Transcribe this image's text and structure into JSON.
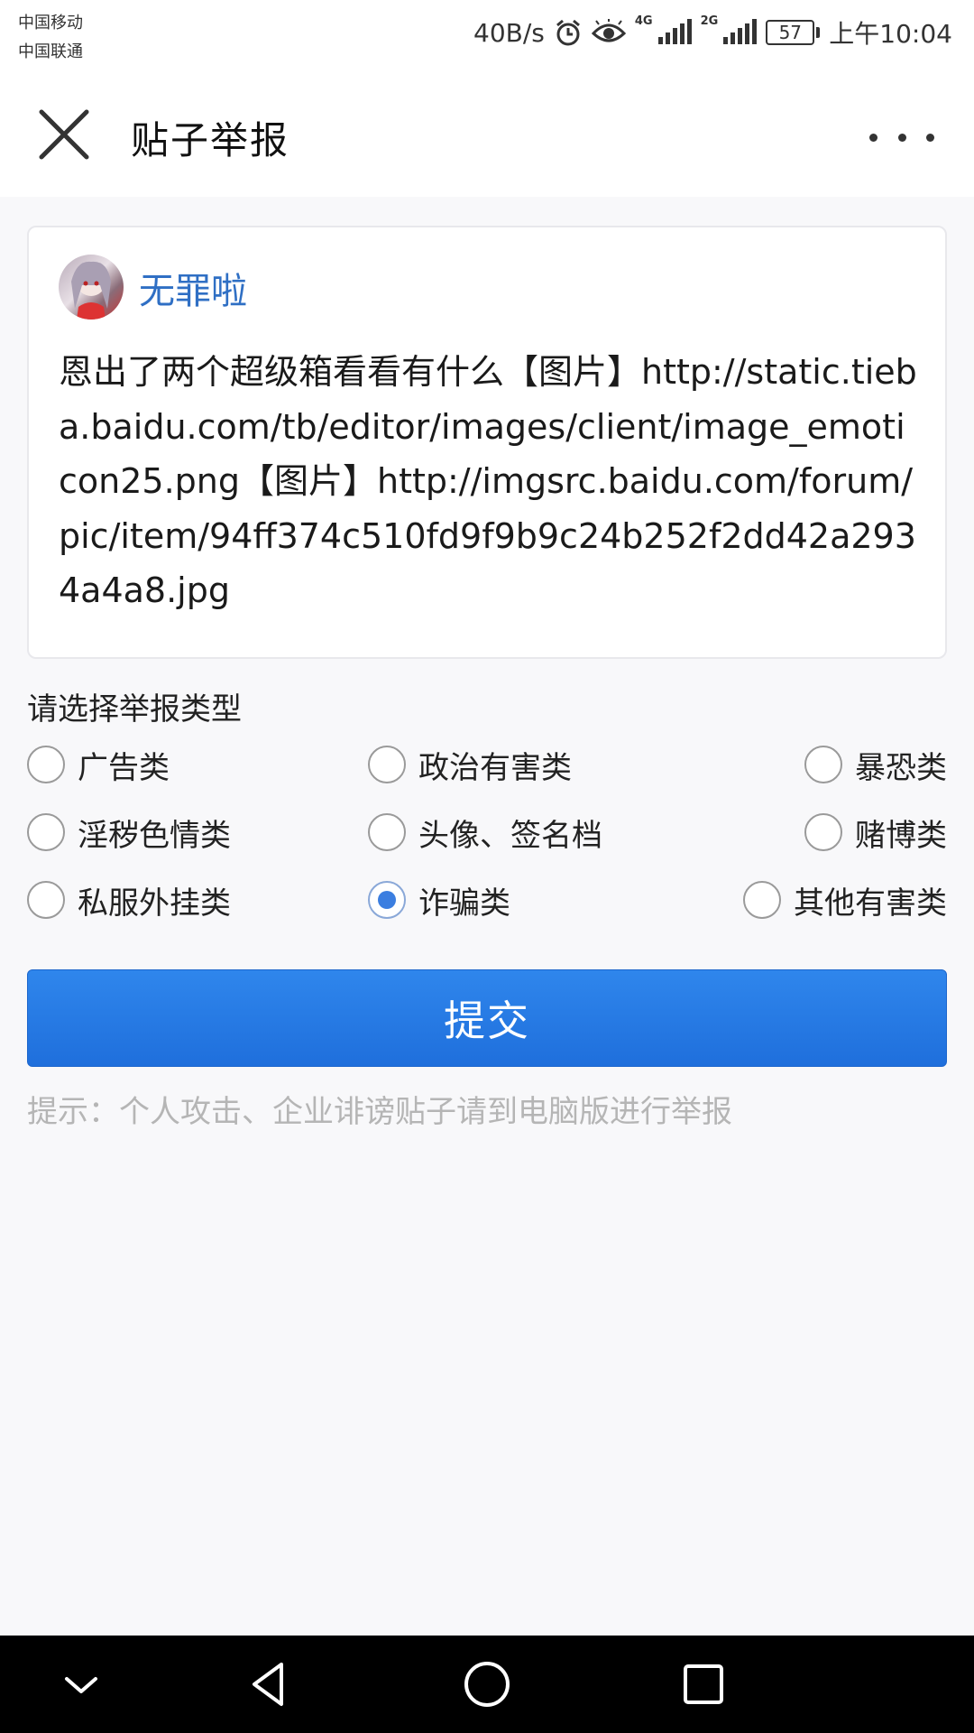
{
  "status_bar": {
    "carrier_1": "中国移动",
    "carrier_2": "中国联通",
    "speed": "40B/s",
    "net_1": "4G",
    "net_2": "2G",
    "battery": "57",
    "time": "上午10:04"
  },
  "header": {
    "title": "贴子举报",
    "close_icon": "close-icon",
    "more_icon": "more-dots-icon"
  },
  "post": {
    "username": "无罪啦",
    "content": "恩出了两个超级箱看看有什么【图片】http://static.tieba.baidu.com/tb/editor/images/client/image_emoticon25.png【图片】http://imgsrc.baidu.com/forum/pic/item/94ff374c510fd9f9b9c24b252f2dd42a2934a4a8.jpg"
  },
  "report": {
    "label": "请选择举报类型",
    "options": [
      {
        "label": "广告类",
        "checked": false
      },
      {
        "label": "政治有害类",
        "checked": false
      },
      {
        "label": "暴恐类",
        "checked": false
      },
      {
        "label": "淫秽色情类",
        "checked": false
      },
      {
        "label": "头像、签名档",
        "checked": false
      },
      {
        "label": "赌博类",
        "checked": false
      },
      {
        "label": "私服外挂类",
        "checked": false
      },
      {
        "label": "诈骗类",
        "checked": true
      },
      {
        "label": "其他有害类",
        "checked": false
      }
    ],
    "submit_label": "提交",
    "hint": "提示：个人攻击、企业诽谤贴子请到电脑版进行举报"
  },
  "colors": {
    "accent": "#2f7fe8",
    "username": "#2f6fc4",
    "hint": "#b5b5b5"
  }
}
